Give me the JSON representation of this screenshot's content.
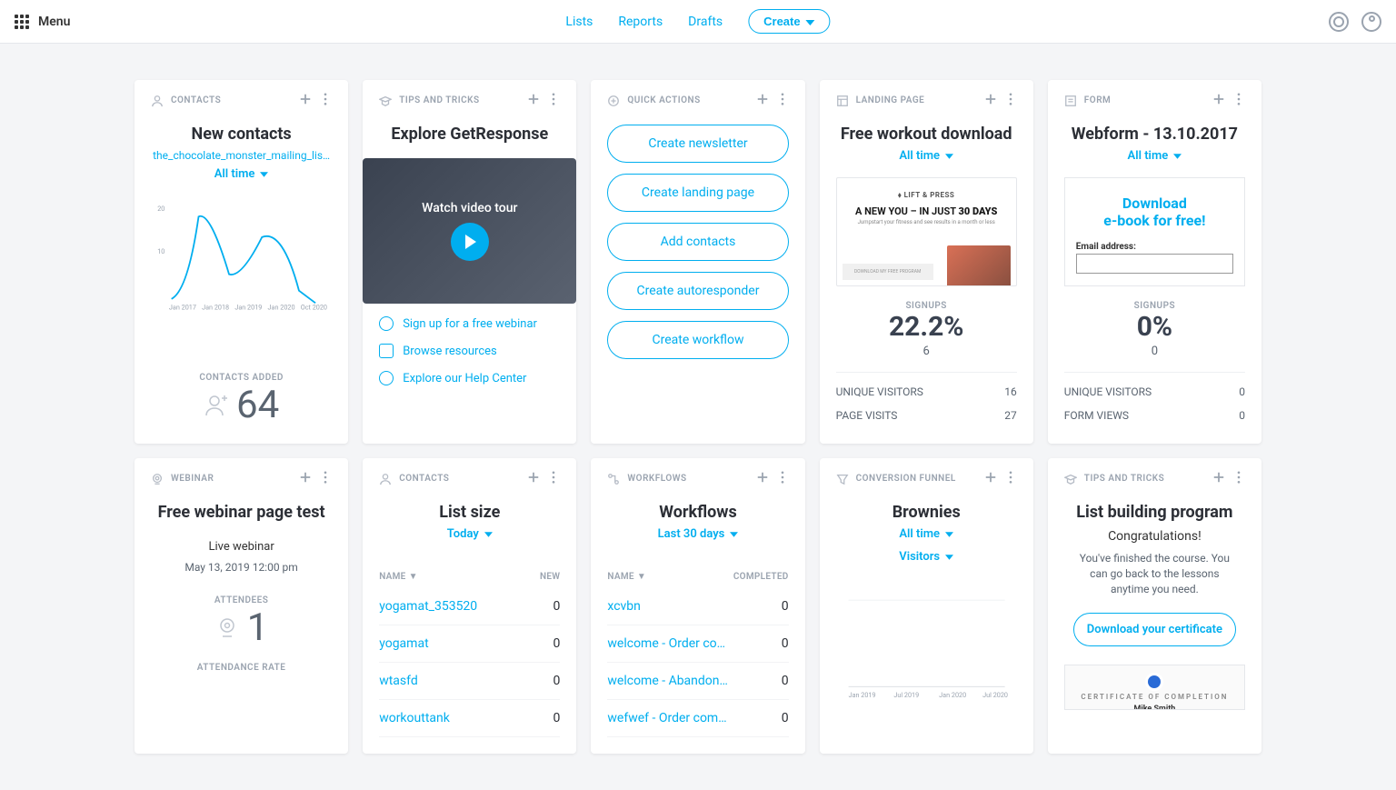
{
  "header": {
    "menu_label": "Menu",
    "nav": {
      "lists": "Lists",
      "reports": "Reports",
      "drafts": "Drafts"
    },
    "create_label": "Create"
  },
  "cards": {
    "contacts": {
      "header": "CONTACTS",
      "title": "New contacts",
      "list_link": "the_chocolate_monster_mailing_lis…",
      "filter": "All time",
      "added_label": "CONTACTS ADDED",
      "added_value": "64"
    },
    "tips": {
      "header": "TIPS AND TRICKS",
      "title": "Explore GetResponse",
      "video_label": "Watch video tour",
      "links": {
        "webinar": "Sign up for a free webinar",
        "resources": "Browse resources",
        "help": "Explore our Help Center"
      }
    },
    "quick": {
      "header": "QUICK ACTIONS",
      "btn1": "Create newsletter",
      "btn2": "Create landing page",
      "btn3": "Add contacts",
      "btn4": "Create autoresponder",
      "btn5": "Create workflow"
    },
    "landing": {
      "header": "LANDING PAGE",
      "title": "Free workout download",
      "filter": "All time",
      "signups_label": "SIGNUPS",
      "signups_pct": "22.2%",
      "signups_num": "6",
      "uv_label": "UNIQUE VISITORS",
      "uv_val": "16",
      "pv_label": "PAGE VISITS",
      "pv_val": "27",
      "preview_logo": "⬧ LIFT & PRESS",
      "preview_headline_a": "A NEW YOU – IN JUST ",
      "preview_headline_b": "30 DAYS",
      "preview_bar": "DOWNLOAD MY FREE PROGRAM"
    },
    "form": {
      "header": "FORM",
      "title": "Webform - 13.10.2017",
      "filter": "All time",
      "preview_title1": "Download",
      "preview_title2": "e-book for free!",
      "preview_label": "Email address:",
      "signups_label": "SIGNUPS",
      "signups_pct": "0%",
      "signups_num": "0",
      "uv_label": "UNIQUE VISITORS",
      "uv_val": "0",
      "fv_label": "FORM VIEWS",
      "fv_val": "0"
    },
    "webinar": {
      "header": "WEBINAR",
      "title": "Free webinar page test",
      "info": "Live webinar",
      "date": "May 13, 2019 12:00 pm",
      "attendees_label": "ATTENDEES",
      "attendees_val": "1",
      "rate_label": "ATTENDANCE RATE"
    },
    "listsize": {
      "header": "CONTACTS",
      "title": "List size",
      "filter": "Today",
      "col_name": "NAME",
      "col_new": "NEW",
      "rows": [
        {
          "name": "yogamat_353520",
          "val": "0"
        },
        {
          "name": "yogamat",
          "val": "0"
        },
        {
          "name": "wtasfd",
          "val": "0"
        },
        {
          "name": "workouttank",
          "val": "0"
        }
      ]
    },
    "workflows": {
      "header": "WORKFLOWS",
      "title": "Workflows",
      "filter": "Last 30 days",
      "col_name": "NAME",
      "col_done": "COMPLETED",
      "rows": [
        {
          "name": "xcvbn",
          "val": "0"
        },
        {
          "name": "welcome - Order co…",
          "val": "0"
        },
        {
          "name": "welcome - Abandon…",
          "val": "0"
        },
        {
          "name": "wefwef - Order com…",
          "val": "0"
        }
      ]
    },
    "funnel": {
      "header": "CONVERSION FUNNEL",
      "title": "Brownies",
      "filter1": "All time",
      "filter2": "Visitors"
    },
    "program": {
      "header": "TIPS AND TRICKS",
      "title": "List building program",
      "cong": "Congratulations!",
      "msg": "You've finished the course. You can go back to the lessons anytime you need.",
      "cert_btn": "Download your certificate",
      "cert_title": "CERTIFICATE OF COMPLETION",
      "cert_name": "Mike Smith"
    }
  },
  "chart_data": {
    "contacts_chart": {
      "type": "line",
      "categories": [
        "Jan 2017",
        "Jan 2018",
        "Jan 2019",
        "Jan 2020",
        "Oct 2020"
      ],
      "values": [
        2,
        19,
        8,
        14,
        0
      ],
      "ylim": [
        0,
        20
      ],
      "yticks": [
        10,
        20
      ]
    },
    "funnel_chart": {
      "type": "bar",
      "categories": [
        "Jan 2019",
        "Jul 2019",
        "Jan 2020",
        "Jul 2020"
      ],
      "values": [
        0,
        0,
        0,
        0
      ]
    }
  }
}
